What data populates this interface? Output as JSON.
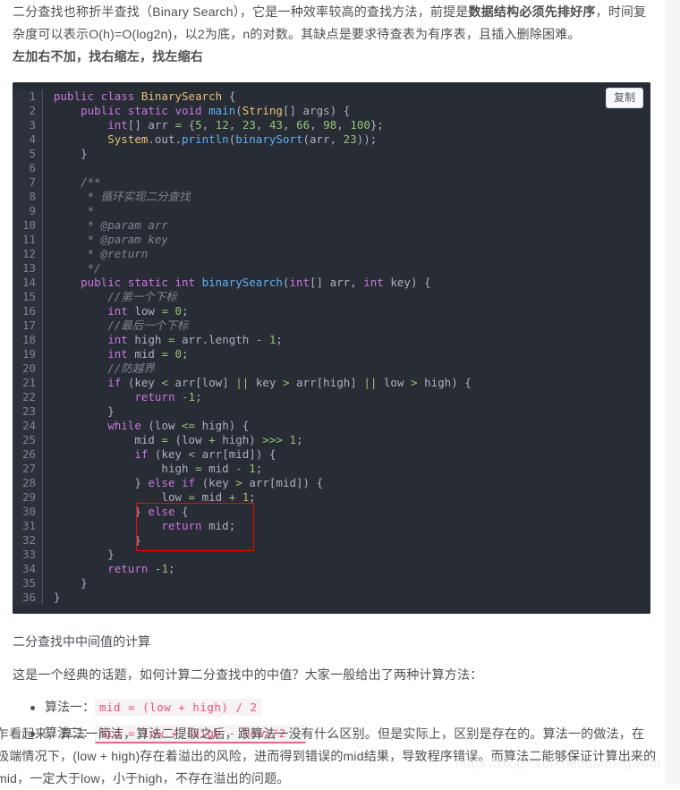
{
  "article": {
    "intro_part1": "二分查找也称折半查找（Binary Search），它是一种效率较高的查找方法，前提是",
    "intro_bold": "数据结构必须先排好序",
    "intro_part2": "，时间复杂度可以表示O(h)=O(log2n)，以2为底，n的对数。其缺点是要求待查表为有序表，且插入删除困难。",
    "rule_line": "左加右不加，找右缩左，找左缩右",
    "section_title": "二分查找中中间值的计算",
    "section_intro": "这是一个经典的话题，如何计算二分查找中的中值？大家一般给出了两种计算方法：",
    "final_paragraph": "乍看起来，算法一简洁，算法二提取之后，跟算法一没有什么区别。但是实际上，区别是存在的。算法一的做法，在极端情况下，(low + high)存在着溢出的风险，进而得到错误的mid结果，导致程序错误。而算法二能够保证计算出来的mid，一定大于low，小于high，不存在溢出的问题。"
  },
  "code_block": {
    "copy_label": "复制",
    "language": "java",
    "total_lines": 36,
    "lines": [
      {
        "n": "1",
        "text": "public class BinarySearch {"
      },
      {
        "n": "2",
        "text": "    public static void main(String[] args) {"
      },
      {
        "n": "3",
        "text": "        int[] arr = {5, 12, 23, 43, 66, 98, 100};"
      },
      {
        "n": "4",
        "text": "        System.out.println(binarySort(arr, 23));"
      },
      {
        "n": "5",
        "text": "    }"
      },
      {
        "n": "6",
        "text": ""
      },
      {
        "n": "7",
        "text": "    /**"
      },
      {
        "n": "8",
        "text": "     * 循环实现二分查找"
      },
      {
        "n": "9",
        "text": "     *"
      },
      {
        "n": "10",
        "text": "     * @param arr"
      },
      {
        "n": "11",
        "text": "     * @param key"
      },
      {
        "n": "12",
        "text": "     * @return"
      },
      {
        "n": "13",
        "text": "     */"
      },
      {
        "n": "14",
        "text": "    public static int binarySearch(int[] arr, int key) {"
      },
      {
        "n": "15",
        "text": "        //第一个下标"
      },
      {
        "n": "16",
        "text": "        int low = 0;"
      },
      {
        "n": "17",
        "text": "        //最后一个下标"
      },
      {
        "n": "18",
        "text": "        int high = arr.length - 1;"
      },
      {
        "n": "19",
        "text": "        int mid = 0;"
      },
      {
        "n": "20",
        "text": "        //防越界"
      },
      {
        "n": "21",
        "text": "        if (key < arr[low] || key > arr[high] || low > high) {"
      },
      {
        "n": "22",
        "text": "            return -1;"
      },
      {
        "n": "23",
        "text": "        }"
      },
      {
        "n": "24",
        "text": "        while (low <= high) {"
      },
      {
        "n": "25",
        "text": "            mid = (low + high) >>> 1;"
      },
      {
        "n": "26",
        "text": "            if (key < arr[mid]) {"
      },
      {
        "n": "27",
        "text": "                high = mid - 1;"
      },
      {
        "n": "28",
        "text": "            } else if (key > arr[mid]) {"
      },
      {
        "n": "29",
        "text": "                low = mid + 1;"
      },
      {
        "n": "30",
        "text": "            } else {"
      },
      {
        "n": "31",
        "text": "                return mid;"
      },
      {
        "n": "32",
        "text": "            }"
      },
      {
        "n": "33",
        "text": "        }"
      },
      {
        "n": "34",
        "text": "        return -1;"
      },
      {
        "n": "35",
        "text": "    }"
      },
      {
        "n": "36",
        "text": "}"
      }
    ],
    "annotation": {
      "type": "red-rectangle",
      "covers_lines": "30-32",
      "color": "#ff0000"
    }
  },
  "algorithms": [
    {
      "label": "算法一：",
      "formula": "mid = (low + high) / 2",
      "underlined": false
    },
    {
      "label": "算法二：",
      "formula": "mid = low + (high - low)/2",
      "underlined": true
    }
  ],
  "watermark": {
    "text": "https://blog.csdn.net/dadongwudi"
  },
  "theme": {
    "code_bg": "#282c34",
    "gutter_bg": "#2c313a",
    "gutter_text": "#7c8495",
    "keyword": "#c678dd",
    "function": "#61afef",
    "type": "#e6c07b",
    "number": "#98c379",
    "comment": "#7f848e",
    "plain": "#abb2bf",
    "inline_code_text": "#e8537a",
    "inline_code_bg": "#f7f2f4",
    "annotation_red": "#ff0000",
    "page_bg": "#ffffff",
    "body_text": "#4f4f4f"
  }
}
